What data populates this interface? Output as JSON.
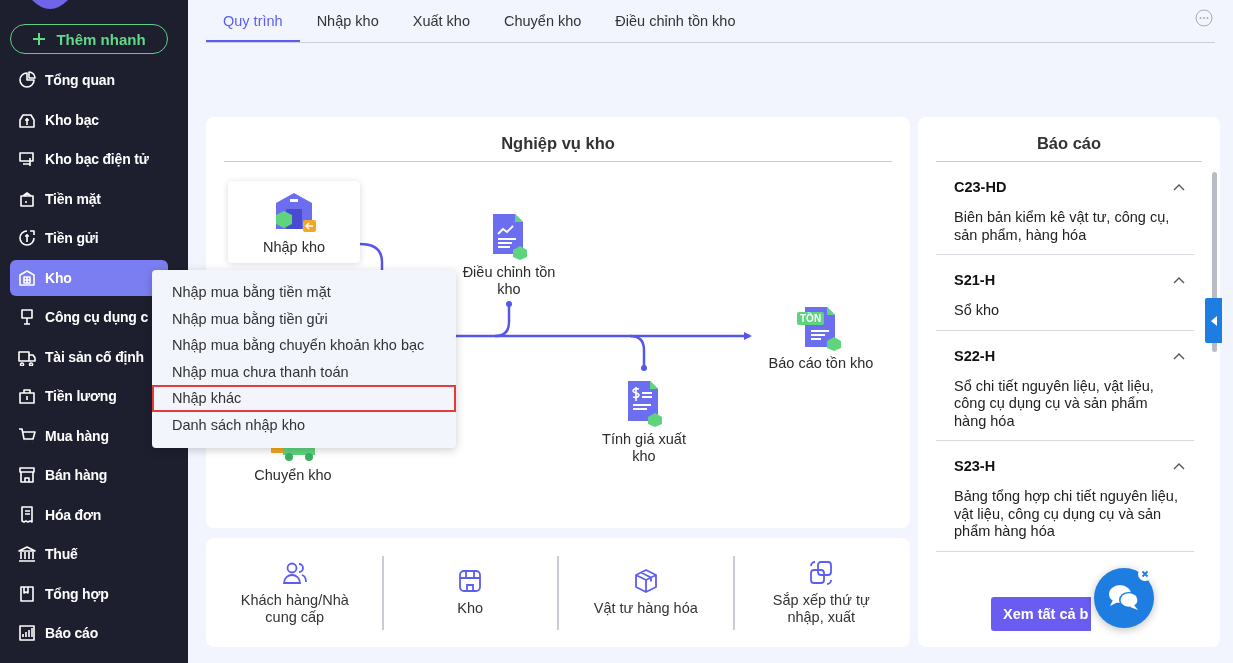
{
  "quick_add": {
    "label": "Thêm nhanh"
  },
  "sidebar": {
    "items": [
      {
        "label": "Tổng quan",
        "selected": false
      },
      {
        "label": "Kho bạc",
        "selected": false
      },
      {
        "label": "Kho bạc điện tử",
        "selected": false
      },
      {
        "label": "Tiền mặt",
        "selected": false
      },
      {
        "label": "Tiền gửi",
        "selected": false
      },
      {
        "label": "Kho",
        "selected": true
      },
      {
        "label": "Công cụ dụng c",
        "selected": false
      },
      {
        "label": "Tài sản cố định",
        "selected": false
      },
      {
        "label": "Tiền lương",
        "selected": false
      },
      {
        "label": "Mua hàng",
        "selected": false
      },
      {
        "label": "Bán hàng",
        "selected": false
      },
      {
        "label": "Hóa đơn",
        "selected": false
      },
      {
        "label": "Thuế",
        "selected": false
      },
      {
        "label": "Tổng hợp",
        "selected": false
      },
      {
        "label": "Báo cáo",
        "selected": false
      }
    ]
  },
  "tabs": [
    {
      "label": "Quy trình",
      "selected": true
    },
    {
      "label": "Nhập kho",
      "selected": false
    },
    {
      "label": "Xuất kho",
      "selected": false
    },
    {
      "label": "Chuyển kho",
      "selected": false
    },
    {
      "label": "Điều chỉnh tồn kho",
      "selected": false
    }
  ],
  "workflow": {
    "title": "Nghiệp vụ kho",
    "nodes": [
      {
        "kind": "import",
        "label": "Nhập kho"
      },
      {
        "kind": "adjust",
        "label": "Điều chỉnh tồn kho"
      },
      {
        "kind": "report",
        "label": "Báo cáo tồn kho",
        "badge": "TỒN"
      },
      {
        "kind": "price",
        "label": "Tính giá xuất kho"
      },
      {
        "kind": "transfer",
        "label": "Chuyển kho"
      }
    ]
  },
  "context_menu": {
    "items": [
      {
        "label": "Nhập mua bằng tiền mặt",
        "selected": false
      },
      {
        "label": "Nhập mua bằng tiền gửi",
        "selected": false
      },
      {
        "label": "Nhập mua bằng chuyển khoản kho bạc",
        "selected": false
      },
      {
        "label": "Nhập mua chưa thanh toán",
        "selected": false
      },
      {
        "label": "Nhập khác",
        "selected": true
      },
      {
        "label": "Danh sách nhập kho",
        "selected": false
      }
    ]
  },
  "shortcuts": [
    {
      "kind": "people",
      "label": "Khách hàng/Nhà cung cấp"
    },
    {
      "kind": "store",
      "label": "Kho"
    },
    {
      "kind": "box",
      "label": "Vật tư hàng hóa"
    },
    {
      "kind": "sort",
      "label": "Sắp xếp thứ tự nhập, xuất"
    }
  ],
  "reports": {
    "title": "Báo cáo",
    "items": [
      {
        "code": "C23-HD",
        "description": "Biên bản kiểm kê vật tư, công cụ, sản phẩm, hàng hóa",
        "expanded": true
      },
      {
        "code": "S21-H",
        "description": "Sổ kho",
        "expanded": true
      },
      {
        "code": "S22-H",
        "description": "Sổ chi tiết nguyên liệu, vật liệu, công cụ dụng cụ và sản phẩm hàng hóa",
        "expanded": true
      },
      {
        "code": "S23-H",
        "description": "Bảng tổng hợp chi tiết nguyên liệu, vật liệu, công cụ dụng cụ và sản phẩm hàng hóa",
        "expanded": true
      }
    ],
    "button": "Xem tất cả b"
  }
}
